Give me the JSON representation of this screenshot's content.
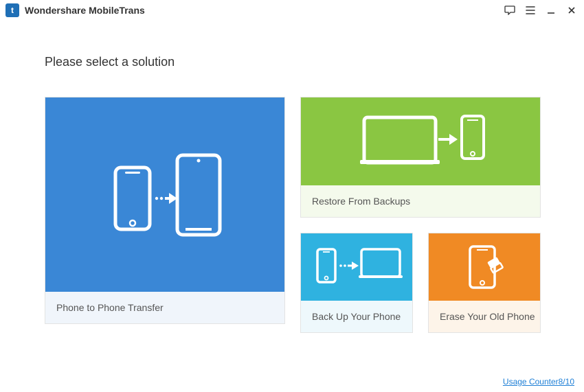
{
  "app": {
    "title": "Wondershare MobileTrans",
    "logo_letter": "t"
  },
  "heading": "Please select a solution",
  "cards": {
    "p2p": {
      "label": "Phone to Phone Transfer"
    },
    "restore": {
      "label": "Restore From Backups"
    },
    "backup": {
      "label": "Back Up Your Phone"
    },
    "erase": {
      "label": "Erase Your Old Phone"
    }
  },
  "footer": {
    "usage_link": "Usage Counter8/10"
  }
}
